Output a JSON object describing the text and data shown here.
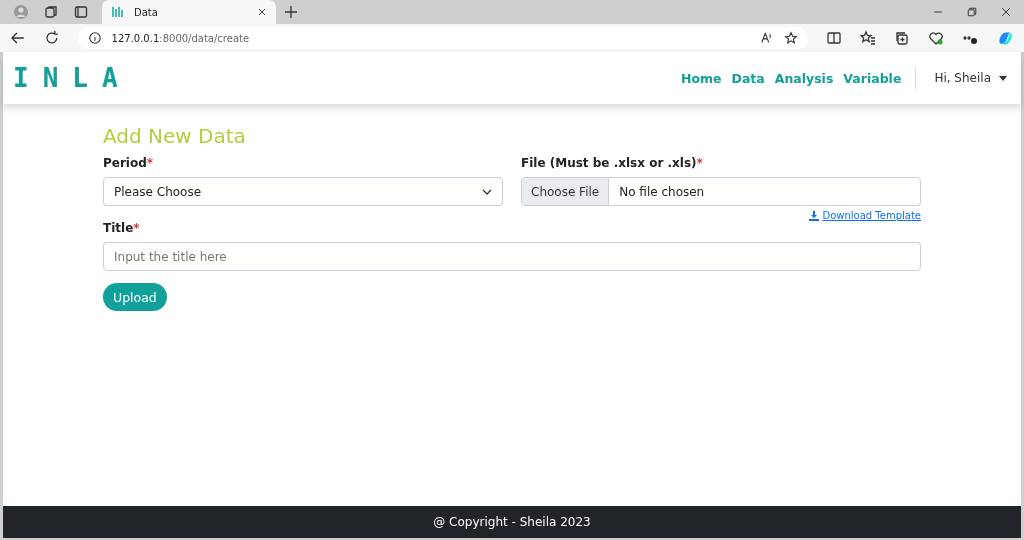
{
  "browser": {
    "tab_title": "Data",
    "url_host": "127.0.0.1",
    "url_path": ":8000/data/create"
  },
  "navbar": {
    "logo": "INLA",
    "links": [
      "Home",
      "Data",
      "Analysis",
      "Variable"
    ],
    "user": "Hi, Sheila"
  },
  "form": {
    "heading": "Add New Data",
    "period": {
      "label": "Period",
      "required": "*",
      "value": "Please Choose"
    },
    "file": {
      "label": "File (Must be .xlsx or .xls)",
      "required": "*",
      "button": "Choose File",
      "status": "No file chosen",
      "link": "Download Template"
    },
    "title": {
      "label": "Title",
      "required": "*",
      "placeholder": "Input the title here"
    },
    "submit": "Upload"
  },
  "footer": "@ Copyright - Sheila 2023"
}
